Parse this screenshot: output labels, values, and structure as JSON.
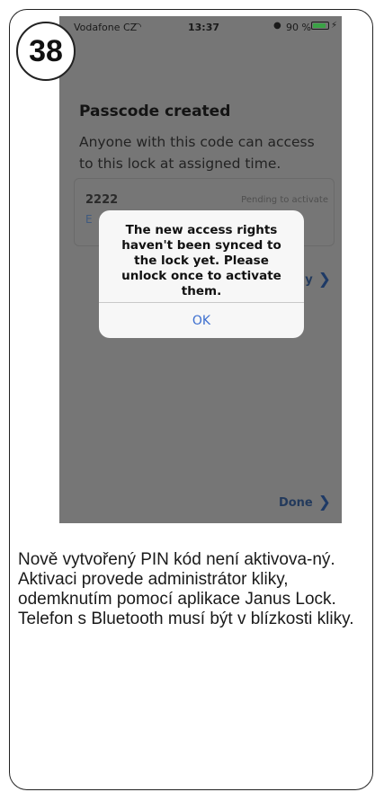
{
  "step": {
    "number": "38"
  },
  "status_bar": {
    "carrier": "Vodafone CZ",
    "wifi_icon": "wifi-icon",
    "time": "13:37",
    "alarm_icon": "alarm-icon",
    "battery_percent": "90 %",
    "battery_level": 0.9,
    "battery_color": "#3aa245",
    "charging_icon": "charging-bolt-icon"
  },
  "screen": {
    "title": "Passcode created",
    "subtitle": "Anyone with this code can access to this lock at assigned time.",
    "passcode": {
      "code": "2222",
      "status": "Pending to activate",
      "subtext_partial": "E"
    },
    "link_partial": "y",
    "done_label": "Done"
  },
  "dialog": {
    "message": "The new access rights haven't been synced to the lock yet. Please unlock once to activate them.",
    "ok_label": "OK",
    "ok_color": "#3d6fcf"
  },
  "instructions": {
    "line1": "Nově vytvořený PIN kód není aktivova-ný.",
    "line2": "Aktivaci provede administrátor kliky, odemknutím pomocí aplikace Janus Lock.",
    "line3": "Telefon s Bluetooth musí být v blízkosti kliky."
  }
}
